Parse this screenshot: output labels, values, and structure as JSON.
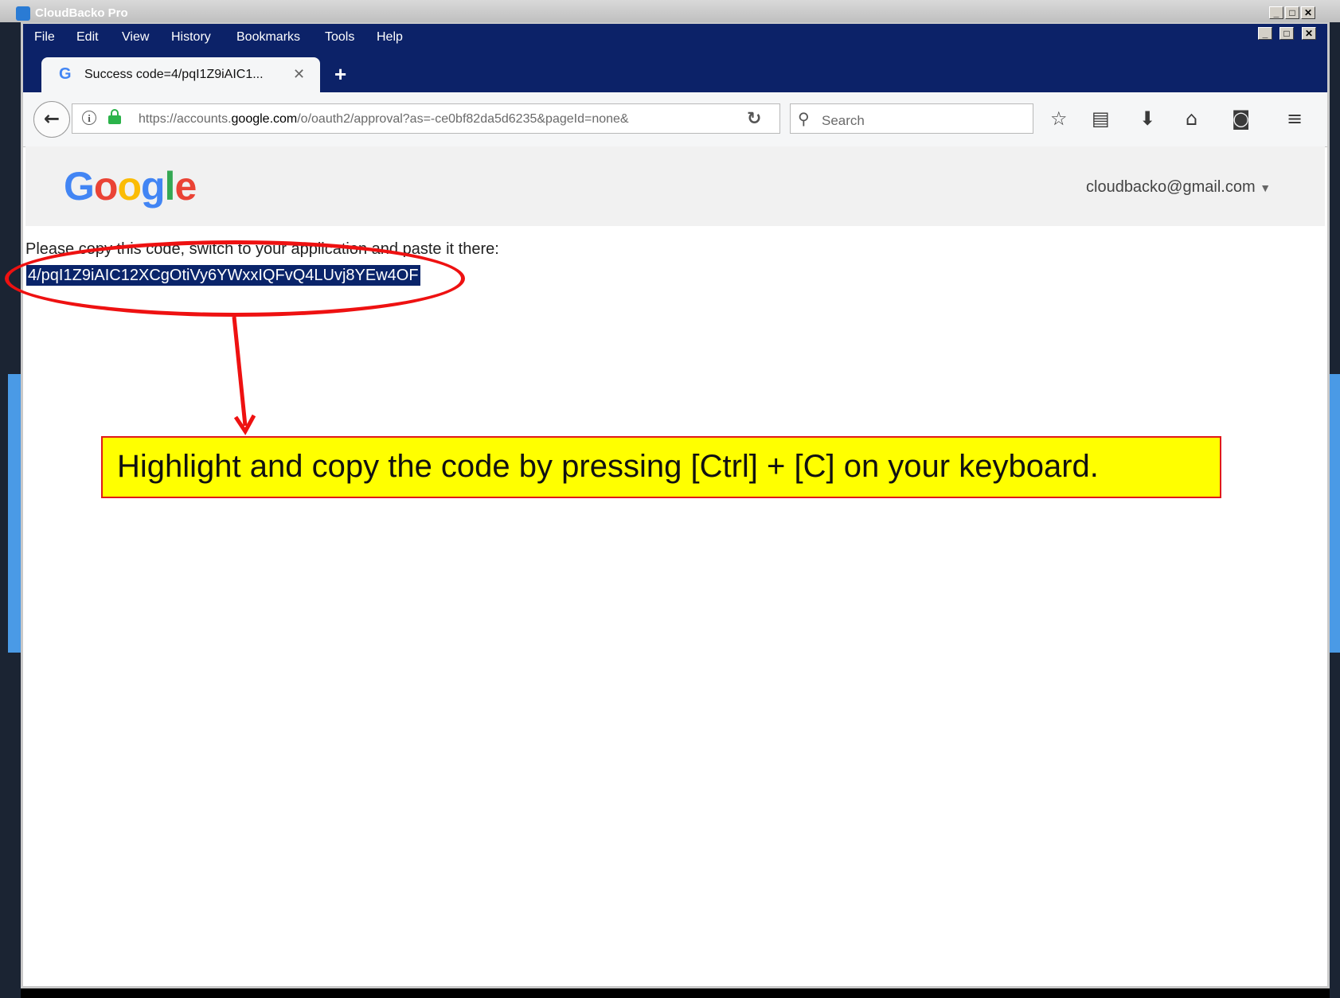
{
  "outer_app": {
    "title": "CloudBacko Pro"
  },
  "browser": {
    "menu": [
      "File",
      "Edit",
      "View",
      "History",
      "Bookmarks",
      "Tools",
      "Help"
    ],
    "tab": {
      "title": "Success code=4/pqI1Z9iAIC1...",
      "favicon": "G"
    },
    "url": {
      "prefix": "https://accounts.",
      "domain": "google.com",
      "path": "/o/oauth2/approval?as=-ce0bf82da5d6235&pageId=none&"
    },
    "search_placeholder": "Search"
  },
  "page": {
    "logo": "Google",
    "account": "cloudbacko@gmail.com",
    "instruction": "Please copy this code, switch to your application and paste it there:",
    "code": "4/pqI1Z9iAIC12XCgOtiVy6YWxxIQFvQ4LUvj8YEw4OF"
  },
  "annotation": {
    "callout": "Highlight and copy the code by pressing [Ctrl] + [C] on your keyboard.",
    "color": "#ee1111",
    "fill": "#ffff00"
  }
}
